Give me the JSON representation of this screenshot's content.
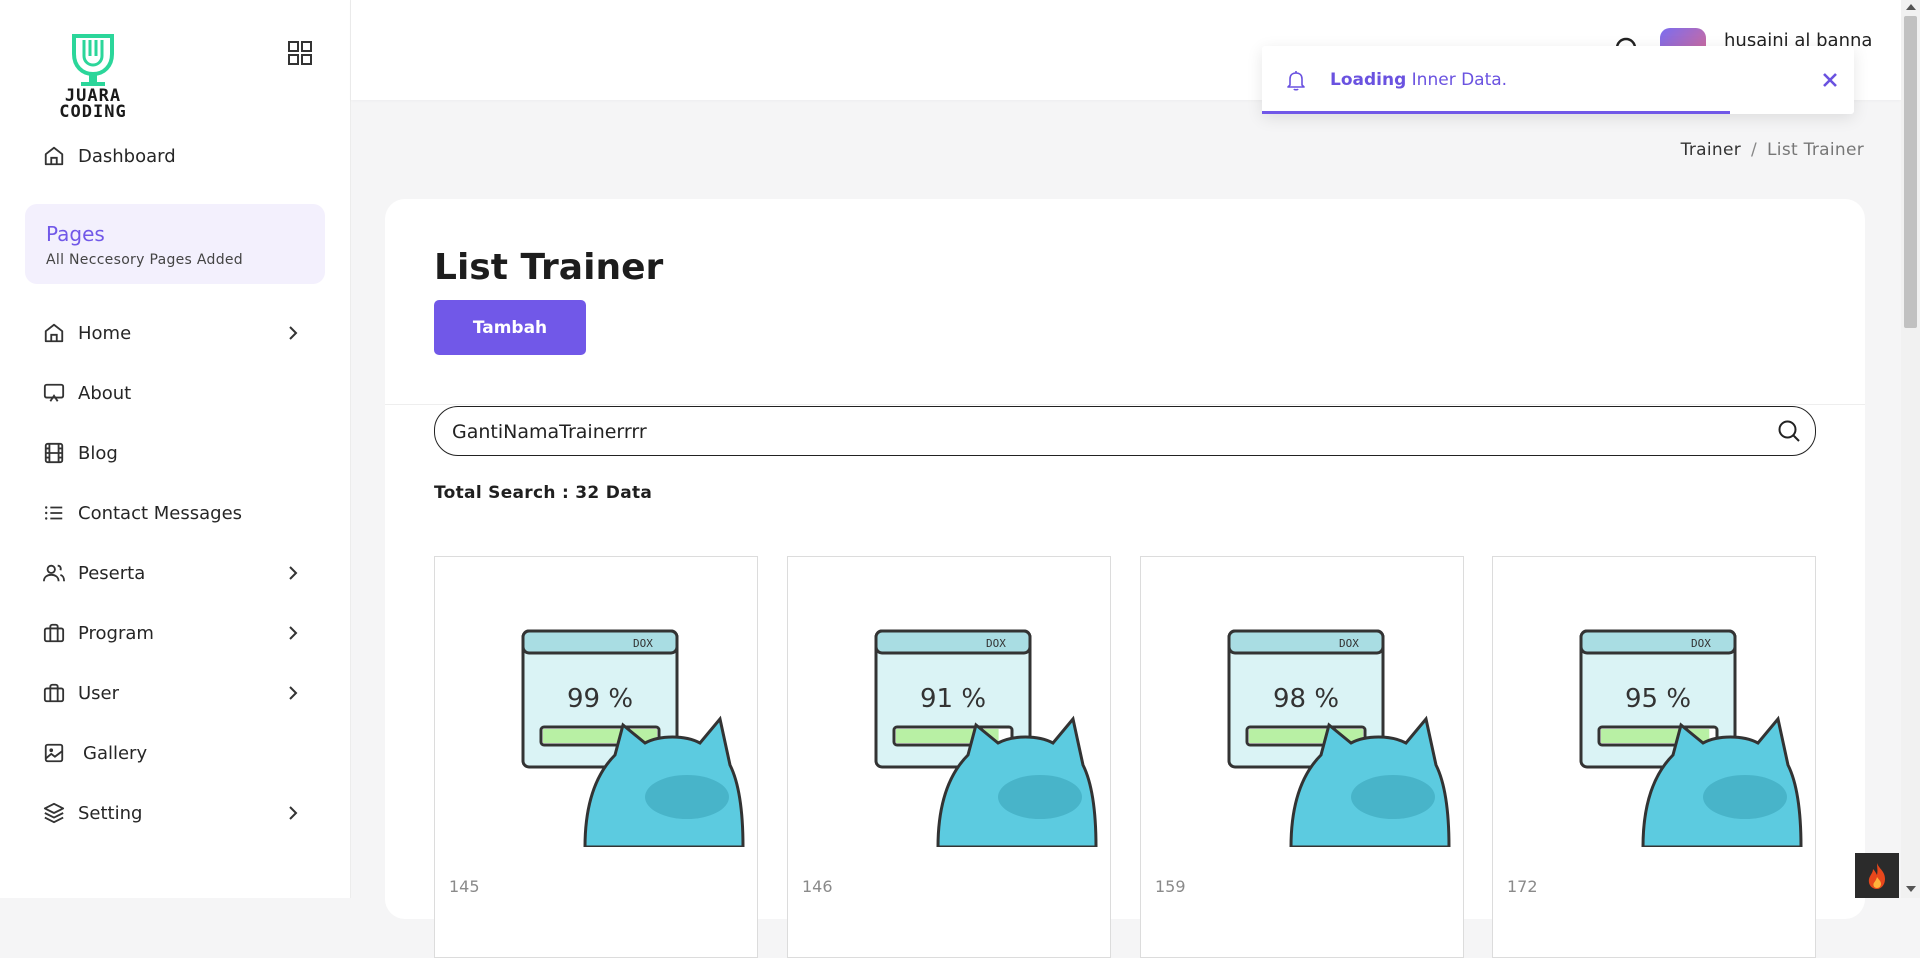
{
  "sidebar": {
    "logo_line1": "JUARA",
    "logo_line2": "CODING",
    "dashboard_label": "Dashboard",
    "pages_title": "Pages",
    "pages_subtitle": "All Neccesory Pages Added",
    "items": [
      {
        "label": "Home",
        "icon": "home-icon",
        "has_submenu": true
      },
      {
        "label": "About",
        "icon": "presentation-icon",
        "has_submenu": false
      },
      {
        "label": "Blog",
        "icon": "film-icon",
        "has_submenu": false
      },
      {
        "label": "Contact Messages",
        "icon": "list-icon",
        "has_submenu": false
      },
      {
        "label": "Peserta",
        "icon": "users-icon",
        "has_submenu": true
      },
      {
        "label": "Program",
        "icon": "briefcase-icon",
        "has_submenu": true
      },
      {
        "label": "User",
        "icon": "briefcase-icon",
        "has_submenu": true
      },
      {
        "label": "Gallery",
        "icon": "image-icon",
        "has_submenu": false
      },
      {
        "label": "Setting",
        "icon": "layers-icon",
        "has_submenu": true
      }
    ]
  },
  "header": {
    "username": "husaini al banna"
  },
  "toast": {
    "bold": "Loading",
    "text": " Inner Data.",
    "progress": 0.79
  },
  "breadcrumb": {
    "parent": "Trainer",
    "separator": "/",
    "current": "List Trainer"
  },
  "main": {
    "title": "List Trainer",
    "add_button": "Tambah",
    "search_value": "GantiNamaTrainerrrr",
    "total_search": "Total Search : 32 Data",
    "tiles": [
      {
        "id": "145",
        "percent": "99 %",
        "fill": 1.0
      },
      {
        "id": "146",
        "percent": "91 %",
        "fill": 0.9
      },
      {
        "id": "159",
        "percent": "98 %",
        "fill": 1.0
      },
      {
        "id": "172",
        "percent": "95 %",
        "fill": 0.95
      }
    ]
  },
  "colors": {
    "accent": "#7158e8",
    "logo_green": "#2bd69a",
    "mascot_blue": "#5ccbe0"
  }
}
